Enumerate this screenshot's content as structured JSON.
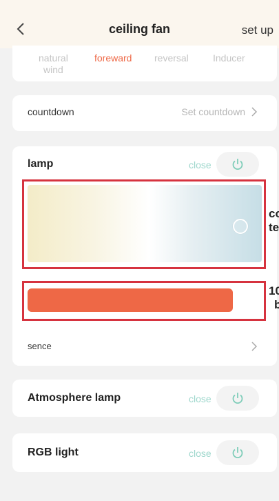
{
  "header": {
    "title": "ceiling fan",
    "setup_label": "set up"
  },
  "modes": [
    {
      "label_line1": "natural",
      "label_line2": "wind",
      "active": false
    },
    {
      "label_line1": "foreward",
      "label_line2": "",
      "active": true
    },
    {
      "label_line1": "reversal",
      "label_line2": "",
      "active": false
    },
    {
      "label_line1": "Inducer",
      "label_line2": "",
      "active": false
    }
  ],
  "countdown": {
    "label": "countdown",
    "value": "Set countdown"
  },
  "lamp": {
    "title": "lamp",
    "state": "close",
    "color_temp_label_a": "co",
    "color_temp_label_b": "te",
    "brightness_label_a": "10",
    "brightness_label_b": "b",
    "brightness_level": 1.0
  },
  "scene": {
    "label": "sence"
  },
  "atmosphere": {
    "title": "Atmosphere lamp",
    "state": "close"
  },
  "rgb": {
    "title": "RGB light",
    "state": "close"
  },
  "colors": {
    "accent": "#ee6846",
    "close_text": "#9ed7cc",
    "annotation": "#d6333f",
    "header_bg": "#fbf6ee"
  }
}
